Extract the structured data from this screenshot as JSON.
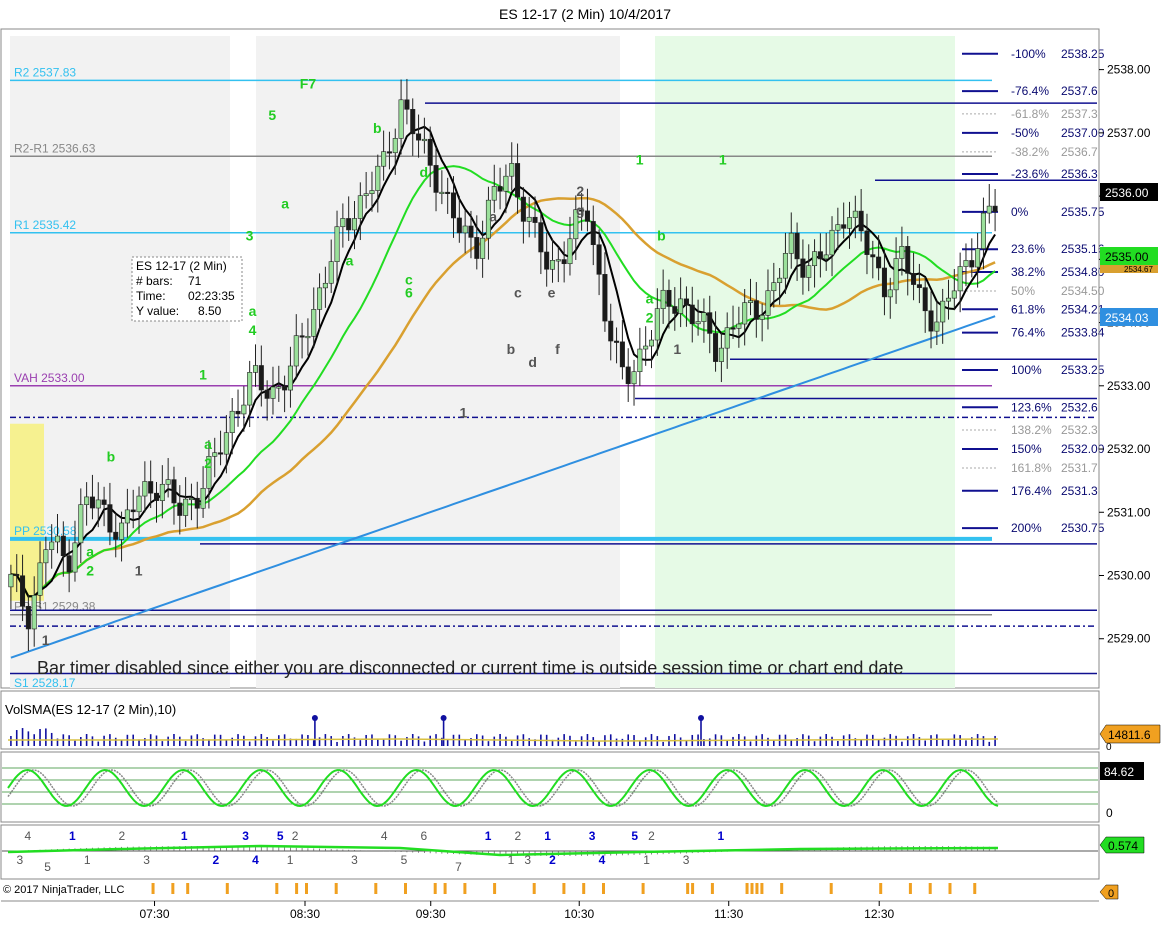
{
  "window": {
    "title": "ES 12-17 (2 Min)  10/4/2017"
  },
  "colors": {
    "pivot": "#33c1f0",
    "up_candle": "#9be09b",
    "down_candle": "#1a1a1a",
    "fast_ma": "#000000",
    "mid_ma": "#22dd22",
    "slow_ma": "#d9a030",
    "long_ma": "#2f8fe0",
    "level_line": "#101090",
    "label_green": "#22cc22",
    "label_grey": "#555555",
    "label_blue": "#0000cc",
    "tag_green": "#22dd22",
    "tag_blue": "#2f8fe0",
    "tag_orange": "#f0a020",
    "session_light": "#f2f2f2",
    "session_green": "#e6fae6",
    "highlight_yellow": "#f6f190"
  },
  "info_box": {
    "title": "ES 12-17 (2 Min)",
    "bars_label": "# bars:",
    "bars_value": "71",
    "time_label": "Time:",
    "time_value": "02:23:35",
    "y_label": "Y value:",
    "y_value": "8.50"
  },
  "status_message": "Bar   timer disabled since either you are disconnected or current time is outside session time or chart end date",
  "copyright": "© 2017 NinjaTrader, LLC",
  "tags": {
    "last_price": "2536.00",
    "ma_price_1": "2535.00",
    "ma_price_2": "2534.67",
    "long_ma_price": "2534.03",
    "volume": "14811.6",
    "stoch": "84.62",
    "osc": "0.574",
    "bottom": "0"
  },
  "chart_data": [
    {
      "type": "candlestick",
      "title": "ES 12-17 (2 Min)  10/4/2017",
      "x_time_labels": [
        "07:30",
        "08:30",
        "09:30",
        "10:30",
        "11:30",
        "12:30"
      ],
      "y_ticks": [
        "2538.00",
        "2537.00",
        "2536.00",
        "2535.00",
        "2534.00",
        "2533.00",
        "2532.00",
        "2531.00",
        "2530.00",
        "2529.00"
      ],
      "ylim": [
        2528.3,
        2538.5
      ],
      "close_path": [
        2529.9,
        2529.4,
        2530.6,
        2530.2,
        2531.2,
        2531.0,
        2530.7,
        2531.3,
        2531.5,
        2531.0,
        2531.3,
        2531.8,
        2532.6,
        2533.1,
        2532.9,
        2533.2,
        2534.0,
        2534.8,
        2535.6,
        2536.0,
        2536.4,
        2537.5,
        2536.8,
        2536.3,
        2535.5,
        2535.2,
        2536.0,
        2536.4,
        2535.5,
        2534.8,
        2535.3,
        2535.8,
        2534.2,
        2533.0,
        2533.6,
        2534.2,
        2534.4,
        2534.0,
        2533.6,
        2534.0,
        2534.2,
        2534.5,
        2535.2,
        2534.9,
        2535.1,
        2535.9,
        2535.2,
        2534.6,
        2535.0,
        2534.4,
        2533.9,
        2534.8,
        2535.2,
        2535.9
      ],
      "pivot_levels": [
        {
          "label": "R2 2537.83",
          "value": 2537.83
        },
        {
          "label": "R2-R1 2536.63",
          "value": 2536.63
        },
        {
          "label": "R1 2535.42",
          "value": 2535.42
        },
        {
          "label": "VAH 2533.00",
          "value": 2533.0
        },
        {
          "label": "PP 2530.58",
          "value": 2530.58
        },
        {
          "label": "PP-S1 2529.38",
          "value": 2529.38
        },
        {
          "label": "S1 2528.17",
          "value": 2528.17
        }
      ],
      "fib_levels": [
        {
          "label": "-100%",
          "price": "2538.25",
          "value": 2538.25
        },
        {
          "label": "-76.4%",
          "price": "2537.6",
          "value": 2537.66
        },
        {
          "label": "-61.8%",
          "price": "2537.3",
          "value": 2537.3
        },
        {
          "label": "-50%",
          "price": "2537.00",
          "value": 2537.0
        },
        {
          "label": "-38.2%",
          "price": "2536.7",
          "value": 2536.7
        },
        {
          "label": "-23.6%",
          "price": "2536.3",
          "value": 2536.35
        },
        {
          "label": "0%",
          "price": "2535.75",
          "value": 2535.75
        },
        {
          "label": "23.6%",
          "price": "2535.16",
          "value": 2535.16
        },
        {
          "label": "38.2%",
          "price": "2534.80",
          "value": 2534.8
        },
        {
          "label": "50%",
          "price": "2534.50",
          "value": 2534.5
        },
        {
          "label": "61.8%",
          "price": "2534.21",
          "value": 2534.21
        },
        {
          "label": "76.4%",
          "price": "2533.84",
          "value": 2533.84
        },
        {
          "label": "100%",
          "price": "2533.25",
          "value": 2533.25
        },
        {
          "label": "123.6%",
          "price": "2532.6",
          "value": 2532.66
        },
        {
          "label": "138.2%",
          "price": "2532.3",
          "value": 2532.3
        },
        {
          "label": "150%",
          "price": "2532.00",
          "value": 2532.0
        },
        {
          "label": "161.8%",
          "price": "2531.7",
          "value": 2531.7
        },
        {
          "label": "176.4%",
          "price": "2531.3",
          "value": 2531.34
        },
        {
          "label": "200%",
          "price": "2530.75",
          "value": 2530.75
        }
      ],
      "wave_labels": [
        {
          "text": "F7",
          "color": "green",
          "t": 0.303,
          "value": 2537.7
        },
        {
          "text": "5",
          "color": "green",
          "t": 0.267,
          "value": 2537.2
        },
        {
          "text": "b",
          "color": "green",
          "t": 0.373,
          "value": 2537.0
        },
        {
          "text": "d",
          "color": "green",
          "t": 0.42,
          "value": 2536.3
        },
        {
          "text": "3",
          "color": "green",
          "t": 0.244,
          "value": 2535.3
        },
        {
          "text": "a",
          "color": "green",
          "t": 0.28,
          "value": 2535.8
        },
        {
          "text": "a",
          "color": "green",
          "t": 0.345,
          "value": 2534.9
        },
        {
          "text": "c",
          "color": "green",
          "t": 0.405,
          "value": 2534.6
        },
        {
          "text": "6",
          "color": "green",
          "t": 0.405,
          "value": 2534.4
        },
        {
          "text": "a",
          "color": "green",
          "t": 0.247,
          "value": 2534.1
        },
        {
          "text": "4",
          "color": "green",
          "t": 0.247,
          "value": 2533.8
        },
        {
          "text": "1",
          "color": "green",
          "t": 0.197,
          "value": 2533.1
        },
        {
          "text": "a",
          "color": "green",
          "t": 0.202,
          "value": 2532.0
        },
        {
          "text": "2",
          "color": "green",
          "t": 0.202,
          "value": 2531.7
        },
        {
          "text": "b",
          "color": "green",
          "t": 0.104,
          "value": 2531.8
        },
        {
          "text": "a",
          "color": "green",
          "t": 0.083,
          "value": 2530.3
        },
        {
          "text": "2",
          "color": "green",
          "t": 0.083,
          "value": 2530.0
        },
        {
          "text": "1",
          "color": "grey",
          "t": 0.038,
          "value": 2528.9
        },
        {
          "text": "1",
          "color": "grey",
          "t": 0.132,
          "value": 2530.0
        },
        {
          "text": "1",
          "color": "grey",
          "t": 0.46,
          "value": 2532.5
        },
        {
          "text": "a",
          "color": "grey",
          "t": 0.49,
          "value": 2535.6
        },
        {
          "text": "c",
          "color": "grey",
          "t": 0.515,
          "value": 2534.4
        },
        {
          "text": "b",
          "color": "grey",
          "t": 0.508,
          "value": 2533.5
        },
        {
          "text": "d",
          "color": "grey",
          "t": 0.53,
          "value": 2533.3
        },
        {
          "text": "e",
          "color": "grey",
          "t": 0.549,
          "value": 2534.4
        },
        {
          "text": "f",
          "color": "grey",
          "t": 0.555,
          "value": 2533.5
        },
        {
          "text": "2",
          "color": "grey",
          "t": 0.578,
          "value": 2536.0
        },
        {
          "text": "g",
          "color": "grey",
          "t": 0.578,
          "value": 2535.7
        },
        {
          "text": "1",
          "color": "green",
          "t": 0.638,
          "value": 2536.5
        },
        {
          "text": "b",
          "color": "green",
          "t": 0.66,
          "value": 2535.3
        },
        {
          "text": "a",
          "color": "green",
          "t": 0.648,
          "value": 2534.3
        },
        {
          "text": "2",
          "color": "green",
          "t": 0.648,
          "value": 2534.0
        },
        {
          "text": "1",
          "color": "grey",
          "t": 0.676,
          "value": 2533.5
        },
        {
          "text": "1",
          "color": "green",
          "t": 0.722,
          "value": 2536.5
        }
      ]
    },
    {
      "type": "bar",
      "title": "VolSMA(ES 12-17 (2 Min),10)",
      "last_value": 14811.6,
      "spikes_at": [
        0.31,
        0.44,
        0.7
      ]
    },
    {
      "type": "line",
      "title": "",
      "last_value": 84.62,
      "y_ticks": [
        "0"
      ]
    },
    {
      "type": "bar",
      "title": "",
      "last_value": 0.574,
      "count_labels": [
        {
          "text": "4",
          "color": "grey",
          "t": 0.02,
          "row": 0
        },
        {
          "text": "3",
          "color": "grey",
          "t": 0.012,
          "row": 1
        },
        {
          "text": "5",
          "color": "grey",
          "t": 0.04,
          "row": 2
        },
        {
          "text": "1",
          "color": "blue",
          "t": 0.065,
          "row": 0
        },
        {
          "text": "1",
          "color": "grey",
          "t": 0.08,
          "row": 1
        },
        {
          "text": "2",
          "color": "grey",
          "t": 0.115,
          "row": 0
        },
        {
          "text": "3",
          "color": "grey",
          "t": 0.14,
          "row": 1
        },
        {
          "text": "1",
          "color": "blue",
          "t": 0.178,
          "row": 0
        },
        {
          "text": "2",
          "color": "blue",
          "t": 0.21,
          "row": 1
        },
        {
          "text": "3",
          "color": "blue",
          "t": 0.24,
          "row": 0
        },
        {
          "text": "4",
          "color": "blue",
          "t": 0.25,
          "row": 1
        },
        {
          "text": "5",
          "color": "blue",
          "t": 0.275,
          "row": 0
        },
        {
          "text": "2",
          "color": "grey",
          "t": 0.29,
          "row": 0
        },
        {
          "text": "1",
          "color": "grey",
          "t": 0.285,
          "row": 1
        },
        {
          "text": "3",
          "color": "grey",
          "t": 0.35,
          "row": 1
        },
        {
          "text": "4",
          "color": "grey",
          "t": 0.38,
          "row": 0
        },
        {
          "text": "5",
          "color": "grey",
          "t": 0.4,
          "row": 1
        },
        {
          "text": "6",
          "color": "grey",
          "t": 0.42,
          "row": 0
        },
        {
          "text": "7",
          "color": "grey",
          "t": 0.455,
          "row": 2
        },
        {
          "text": "1",
          "color": "blue",
          "t": 0.485,
          "row": 0
        },
        {
          "text": "1",
          "color": "grey",
          "t": 0.508,
          "row": 1
        },
        {
          "text": "2",
          "color": "grey",
          "t": 0.515,
          "row": 0
        },
        {
          "text": "3",
          "color": "grey",
          "t": 0.525,
          "row": 1
        },
        {
          "text": "1",
          "color": "blue",
          "t": 0.545,
          "row": 0
        },
        {
          "text": "2",
          "color": "blue",
          "t": 0.55,
          "row": 1
        },
        {
          "text": "3",
          "color": "blue",
          "t": 0.59,
          "row": 0
        },
        {
          "text": "4",
          "color": "blue",
          "t": 0.6,
          "row": 1
        },
        {
          "text": "5",
          "color": "blue",
          "t": 0.633,
          "row": 0
        },
        {
          "text": "2",
          "color": "grey",
          "t": 0.65,
          "row": 0
        },
        {
          "text": "1",
          "color": "grey",
          "t": 0.645,
          "row": 1
        },
        {
          "text": "3",
          "color": "grey",
          "t": 0.685,
          "row": 1
        },
        {
          "text": "1",
          "color": "blue",
          "t": 0.72,
          "row": 0
        }
      ]
    }
  ]
}
